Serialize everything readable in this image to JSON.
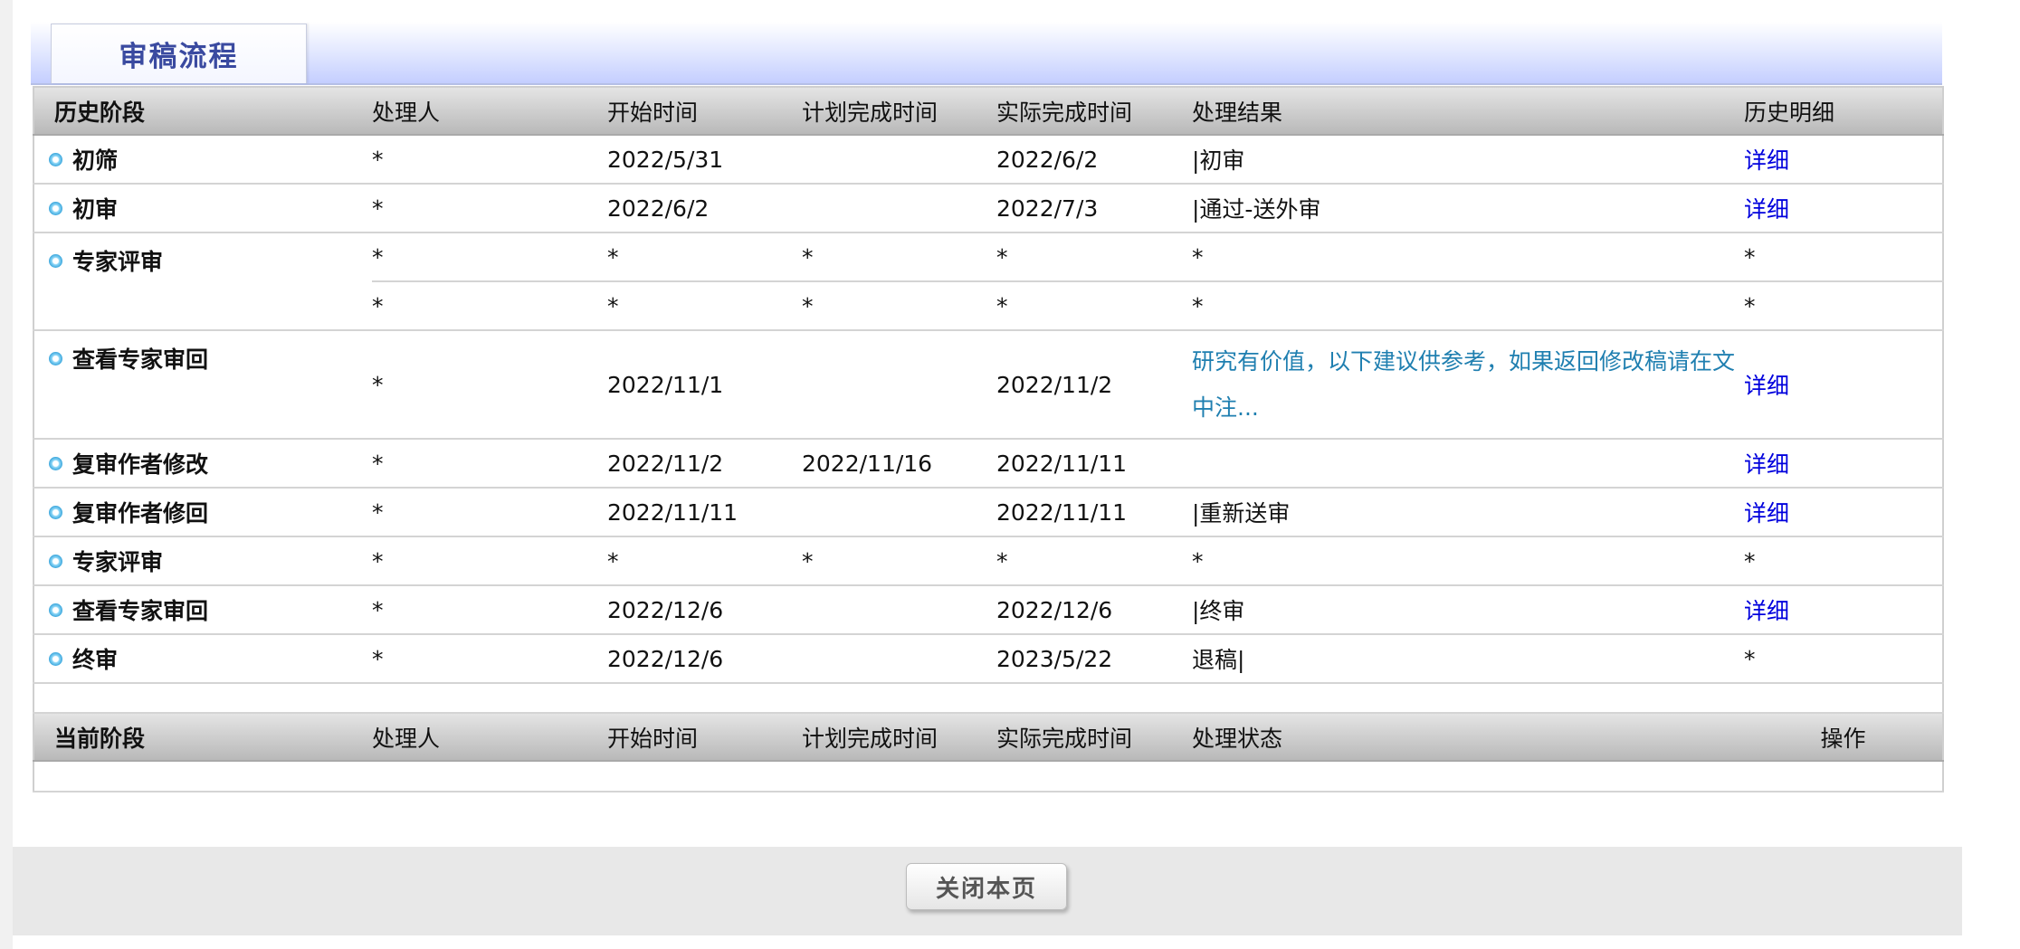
{
  "tab_title": "审稿流程",
  "history_header": {
    "stage": "历史阶段",
    "handler": "处理人",
    "start": "开始时间",
    "planned": "计划完成时间",
    "actual": "实际完成时间",
    "result": "处理结果",
    "detail": "历史明细"
  },
  "history": [
    {
      "stage": "初筛",
      "handler": "*",
      "start": "2022/5/31",
      "planned": "",
      "actual": "2022/6/2",
      "result": "|初审",
      "detail": "详细"
    },
    {
      "stage": "初审",
      "handler": "*",
      "start": "2022/6/2",
      "planned": "",
      "actual": "2022/7/3",
      "result": "|通过-送外审",
      "detail": "详细"
    },
    {
      "stage": "专家评审",
      "handler": "*",
      "start": "*",
      "planned": "*",
      "actual": "*",
      "result": "*",
      "detail": "*"
    },
    {
      "stage": "",
      "handler": "*",
      "start": "*",
      "planned": "*",
      "actual": "*",
      "result": "*",
      "detail": "*"
    },
    {
      "stage": "查看专家审回",
      "handler": "*",
      "start": "2022/11/1",
      "planned": "",
      "actual": "2022/11/2",
      "result": "研究有价值，以下建议供参考，如果返回修改稿请在文中注...",
      "detail": "详细"
    },
    {
      "stage": "复审作者修改",
      "handler": "*",
      "start": "2022/11/2",
      "planned": "2022/11/16",
      "actual": "2022/11/11",
      "result": "",
      "detail": "详细"
    },
    {
      "stage": "复审作者修回",
      "handler": "*",
      "start": "2022/11/11",
      "planned": "",
      "actual": "2022/11/11",
      "result": "|重新送审",
      "detail": "详细"
    },
    {
      "stage": "专家评审",
      "handler": "*",
      "start": "*",
      "planned": "*",
      "actual": "*",
      "result": "*",
      "detail": "*"
    },
    {
      "stage": "查看专家审回",
      "handler": "*",
      "start": "2022/12/6",
      "planned": "",
      "actual": "2022/12/6",
      "result": "|终审",
      "detail": "详细"
    },
    {
      "stage": "终审",
      "handler": "*",
      "start": "2022/12/6",
      "planned": "",
      "actual": "2023/5/22",
      "result": "退稿|",
      "detail": "*"
    }
  ],
  "current_header": {
    "stage": "当前阶段",
    "handler": "处理人",
    "start": "开始时间",
    "planned": "计划完成时间",
    "actual": "实际完成时间",
    "status": "处理状态",
    "operation": "操作"
  },
  "close_button": "关闭本页"
}
